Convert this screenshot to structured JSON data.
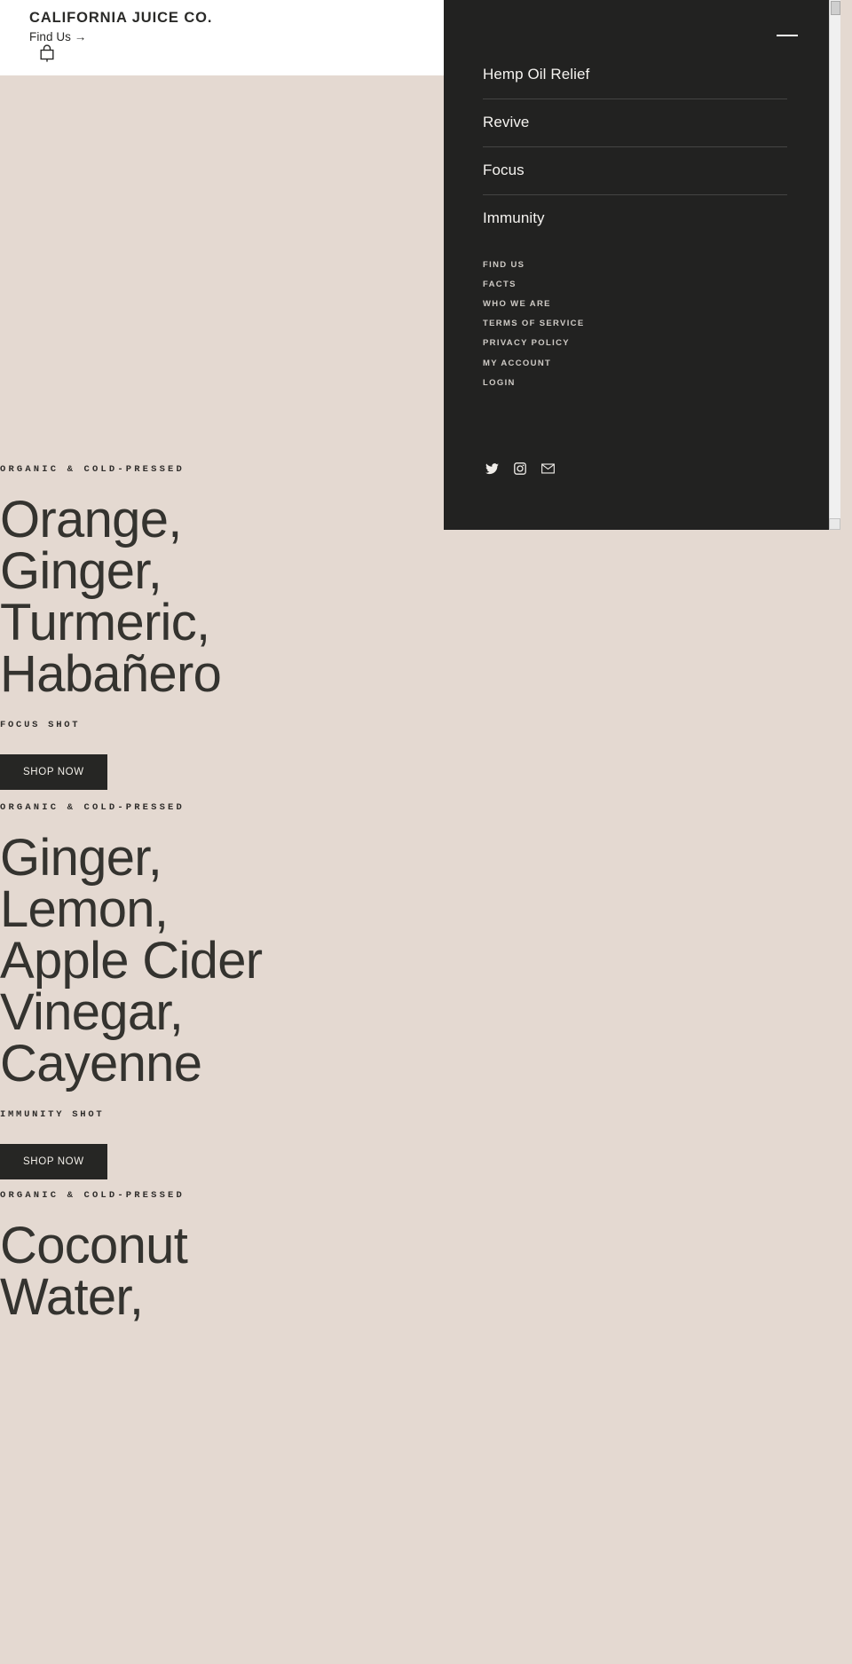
{
  "header": {
    "brand": "CALIFORNIA JUICE CO.",
    "find_us": "Find Us →",
    "cart_icon": "shopping-bag-icon"
  },
  "products": [
    {
      "eyebrow": "ORGANIC & COLD-PRESSED",
      "headline_lines": [
        "Orange,",
        "Ginger,",
        "Turmeric,",
        "Habañero"
      ],
      "subline": "FOCUS SHOT",
      "cta": "SHOP NOW"
    },
    {
      "eyebrow": "ORGANIC & COLD-PRESSED",
      "headline_lines": [
        "Ginger,",
        "Lemon,",
        "Apple Cider",
        "Vinegar,",
        "Cayenne"
      ],
      "subline": "IMMUNITY SHOT",
      "cta": "SHOP NOW"
    },
    {
      "eyebrow": "ORGANIC & COLD-PRESSED",
      "headline_lines": [
        "Coconut",
        "Water,"
      ],
      "subline": "",
      "cta": ""
    }
  ],
  "menu": {
    "close_label": "close-menu",
    "primary": [
      {
        "label": "Hemp Oil Relief"
      },
      {
        "label": "Revive"
      },
      {
        "label": "Focus"
      },
      {
        "label": "Immunity"
      }
    ],
    "secondary": [
      {
        "label": "FIND US"
      },
      {
        "label": "FACTS"
      },
      {
        "label": "WHO WE ARE"
      },
      {
        "label": "TERMS OF SERVICE"
      },
      {
        "label": "PRIVACY POLICY"
      },
      {
        "label": "MY ACCOUNT"
      },
      {
        "label": "LOGIN"
      }
    ],
    "social": [
      {
        "name": "twitter-icon"
      },
      {
        "name": "instagram-icon"
      },
      {
        "name": "email-icon"
      }
    ]
  },
  "colors": {
    "page_background": "#e4d9d1",
    "topbar_background": "#ffffff",
    "menu_background": "#222221",
    "text_dark": "#34332f",
    "text_light": "#f5f3f0",
    "button_background": "#262624"
  }
}
